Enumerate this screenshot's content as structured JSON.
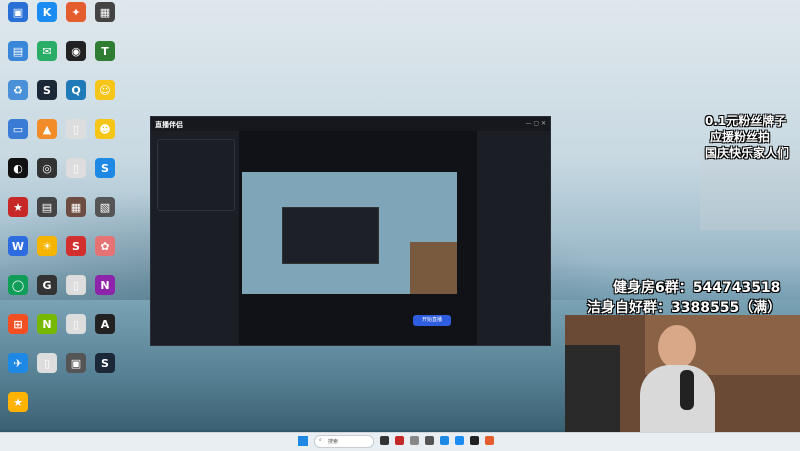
{
  "desktop": {
    "icons": [
      {
        "label": "",
        "color": "#2a6fd6",
        "glyph": "▣"
      },
      {
        "label": "",
        "color": "#1b8cf2",
        "glyph": "K"
      },
      {
        "label": "",
        "color": "#e35d2f",
        "glyph": "✦"
      },
      {
        "label": "",
        "color": "#444",
        "glyph": "▦"
      },
      {
        "label": "",
        "color": "#3a86d8",
        "glyph": "▤"
      },
      {
        "label": "",
        "color": "#2aae67",
        "glyph": "✉"
      },
      {
        "label": "",
        "color": "#222",
        "glyph": "◉"
      },
      {
        "label": "",
        "color": "#2e7d32",
        "glyph": "T"
      },
      {
        "label": "",
        "color": "#4a90d9",
        "glyph": "♻"
      },
      {
        "label": "",
        "color": "#1b2838",
        "glyph": "S"
      },
      {
        "label": "",
        "color": "#1f7ab8",
        "glyph": "Q"
      },
      {
        "label": "",
        "color": "#f5c518",
        "glyph": "☺"
      },
      {
        "label": "",
        "color": "#3a7bd5",
        "glyph": "▭"
      },
      {
        "label": "",
        "color": "#f28c28",
        "glyph": "▲"
      },
      {
        "label": "",
        "color": "#ddd",
        "glyph": "▯"
      },
      {
        "label": "",
        "color": "#f5c518",
        "glyph": "☻"
      },
      {
        "label": "",
        "color": "#111",
        "glyph": "◐"
      },
      {
        "label": "",
        "color": "#333",
        "glyph": "◎"
      },
      {
        "label": "",
        "color": "#ddd",
        "glyph": "▯"
      },
      {
        "label": "",
        "color": "#1e88e5",
        "glyph": "S"
      },
      {
        "label": "",
        "color": "#c62828",
        "glyph": "★"
      },
      {
        "label": "",
        "color": "#444",
        "glyph": "▤"
      },
      {
        "label": "",
        "color": "#6d4c41",
        "glyph": "▦"
      },
      {
        "label": "",
        "color": "#555",
        "glyph": "▧"
      },
      {
        "label": "",
        "color": "#2d6cdf",
        "glyph": "W"
      },
      {
        "label": "",
        "color": "#f4b400",
        "glyph": "☀"
      },
      {
        "label": "",
        "color": "#d32f2f",
        "glyph": "S"
      },
      {
        "label": "",
        "color": "#e57373",
        "glyph": "✿"
      },
      {
        "label": "",
        "color": "#0f9d58",
        "glyph": "◯"
      },
      {
        "label": "",
        "color": "#333",
        "glyph": "G"
      },
      {
        "label": "",
        "color": "#ddd",
        "glyph": "▯"
      },
      {
        "label": "",
        "color": "#8e24aa",
        "glyph": "N"
      },
      {
        "label": "",
        "color": "#f25022",
        "glyph": "⊞"
      },
      {
        "label": "",
        "color": "#76b900",
        "glyph": "N"
      },
      {
        "label": "",
        "color": "#ddd",
        "glyph": "▯"
      },
      {
        "label": "",
        "color": "#222",
        "glyph": "A"
      },
      {
        "label": "",
        "color": "#1e88e5",
        "glyph": "✈"
      },
      {
        "label": "",
        "color": "#ddd",
        "glyph": "▯"
      },
      {
        "label": "",
        "color": "#555",
        "glyph": "▣"
      },
      {
        "label": "",
        "color": "#1b2838",
        "glyph": "S"
      },
      {
        "label": "",
        "color": "#ffb300",
        "glyph": "★"
      }
    ]
  },
  "app": {
    "title": "直播伴侣",
    "start_button": "开始直播"
  },
  "overlay": {
    "line1": "0.1元粉丝牌子",
    "line2": "应援粉丝拍",
    "line3": "国庆快乐家人们",
    "group1": "健身房6群：544743518",
    "group2": "洁身自好群：3388555（满）"
  },
  "taskbar": {
    "search_placeholder": "搜索"
  }
}
